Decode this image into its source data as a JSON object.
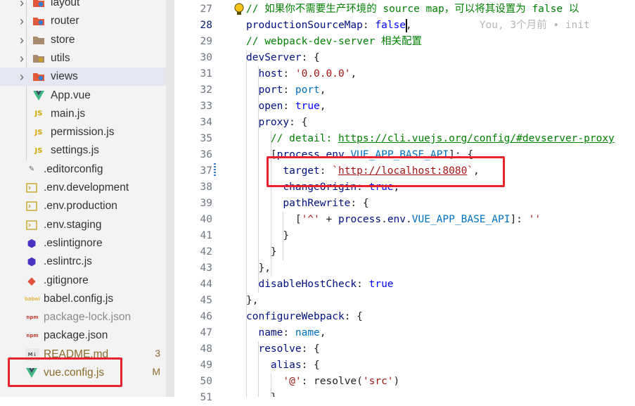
{
  "explorer": {
    "items": [
      {
        "label": "layout",
        "kind": "folder",
        "icon": "layout-folder-icon"
      },
      {
        "label": "router",
        "kind": "folder",
        "icon": "router-folder-icon"
      },
      {
        "label": "store",
        "kind": "folder",
        "icon": "store-folder-icon"
      },
      {
        "label": "utils",
        "kind": "folder",
        "icon": "utils-folder-icon"
      },
      {
        "label": "views",
        "kind": "folder",
        "icon": "views-folder-icon"
      },
      {
        "label": "App.vue",
        "kind": "file",
        "icon": "vue-file-icon"
      },
      {
        "label": "main.js",
        "kind": "file",
        "icon": "js-file-icon"
      },
      {
        "label": "permission.js",
        "kind": "file",
        "icon": "js-file-icon"
      },
      {
        "label": "settings.js",
        "kind": "file",
        "icon": "js-file-icon"
      },
      {
        "label": ".editorconfig",
        "kind": "file",
        "icon": "editorconfig-icon"
      },
      {
        "label": ".env.development",
        "kind": "file",
        "icon": "env-file-icon"
      },
      {
        "label": ".env.production",
        "kind": "file",
        "icon": "env-file-icon"
      },
      {
        "label": ".env.staging",
        "kind": "file",
        "icon": "env-file-icon"
      },
      {
        "label": ".eslintignore",
        "kind": "file",
        "icon": "eslint-icon"
      },
      {
        "label": ".eslintrc.js",
        "kind": "file",
        "icon": "eslint-icon"
      },
      {
        "label": ".gitignore",
        "kind": "file",
        "icon": "git-icon"
      },
      {
        "label": "babel.config.js",
        "kind": "file",
        "icon": "babel-icon"
      },
      {
        "label": "package-lock.json",
        "kind": "file",
        "icon": "npm-icon"
      },
      {
        "label": "package.json",
        "kind": "file",
        "icon": "npm-icon"
      },
      {
        "label": "README.md",
        "kind": "file",
        "icon": "markdown-icon",
        "badge": "3"
      },
      {
        "label": "vue.config.js",
        "kind": "file",
        "icon": "vue-file-icon",
        "badge": "M"
      }
    ],
    "icon_glyphs": {
      "js": "JS",
      "npm": "npm",
      "md": "M↓",
      "babel": "babel"
    }
  },
  "editor": {
    "line_numbers": [
      "27",
      "28",
      "29",
      "30",
      "31",
      "32",
      "33",
      "34",
      "35",
      "36",
      "37",
      "38",
      "39",
      "40",
      "41",
      "42",
      "43",
      "44",
      "45",
      "46",
      "47",
      "48",
      "49",
      "50",
      "51"
    ],
    "current_line": "28",
    "lines": [
      [
        {
          "t": "// 如果你不需要生产环境的 source map，可以将其设置为 false 以",
          "c": "cm"
        }
      ],
      [
        {
          "t": "productionSourceMap",
          "c": "prop"
        },
        {
          "t": ": ",
          "c": "plain"
        },
        {
          "t": "false",
          "c": "kw"
        },
        {
          "t": ",",
          "c": "plain"
        },
        {
          "t": "           You, 3个月前 • init",
          "c": "blame"
        }
      ],
      [
        {
          "t": "// webpack-dev-server 相关配置",
          "c": "cm"
        }
      ],
      [
        {
          "t": "devServer",
          "c": "prop"
        },
        {
          "t": ": {",
          "c": "plain"
        }
      ],
      [
        {
          "t": "  host",
          "c": "prop"
        },
        {
          "t": ": ",
          "c": "plain"
        },
        {
          "t": "'0.0.0.0'",
          "c": "str"
        },
        {
          "t": ",",
          "c": "plain"
        }
      ],
      [
        {
          "t": "  port",
          "c": "prop"
        },
        {
          "t": ": ",
          "c": "plain"
        },
        {
          "t": "port",
          "c": "const"
        },
        {
          "t": ",",
          "c": "plain"
        }
      ],
      [
        {
          "t": "  open",
          "c": "prop"
        },
        {
          "t": ": ",
          "c": "plain"
        },
        {
          "t": "true",
          "c": "kw"
        },
        {
          "t": ",",
          "c": "plain"
        }
      ],
      [
        {
          "t": "  proxy",
          "c": "prop"
        },
        {
          "t": ": {",
          "c": "plain"
        }
      ],
      [
        {
          "t": "    // detail: ",
          "c": "cm"
        },
        {
          "t": "https://cli.vuejs.org/config/#devserver-proxy",
          "c": "cmlink"
        }
      ],
      [
        {
          "t": "    [",
          "c": "plain"
        },
        {
          "t": "process",
          "c": "prop"
        },
        {
          "t": ".",
          "c": "plain"
        },
        {
          "t": "env",
          "c": "prop"
        },
        {
          "t": ".",
          "c": "plain"
        },
        {
          "t": "VUE_APP_BASE_API",
          "c": "const"
        },
        {
          "t": "]: {",
          "c": "plain"
        }
      ],
      [
        {
          "t": "      target",
          "c": "prop"
        },
        {
          "t": ": ",
          "c": "plain"
        },
        {
          "t": "`",
          "c": "str"
        },
        {
          "t": "http://localhost:8080",
          "c": "link"
        },
        {
          "t": "`",
          "c": "str"
        },
        {
          "t": ",",
          "c": "plain"
        }
      ],
      [
        {
          "t": "      changeOrigin",
          "c": "prop"
        },
        {
          "t": ": ",
          "c": "plain"
        },
        {
          "t": "true",
          "c": "kw"
        },
        {
          "t": ",",
          "c": "plain"
        }
      ],
      [
        {
          "t": "      pathRewrite",
          "c": "prop"
        },
        {
          "t": ": {",
          "c": "plain"
        }
      ],
      [
        {
          "t": "        [",
          "c": "plain"
        },
        {
          "t": "'^'",
          "c": "str"
        },
        {
          "t": " + ",
          "c": "plain"
        },
        {
          "t": "process",
          "c": "prop"
        },
        {
          "t": ".",
          "c": "plain"
        },
        {
          "t": "env",
          "c": "prop"
        },
        {
          "t": ".",
          "c": "plain"
        },
        {
          "t": "VUE_APP_BASE_API",
          "c": "const"
        },
        {
          "t": "]: ",
          "c": "plain"
        },
        {
          "t": "''",
          "c": "str"
        }
      ],
      [
        {
          "t": "      }",
          "c": "plain"
        }
      ],
      [
        {
          "t": "    }",
          "c": "plain"
        }
      ],
      [
        {
          "t": "  },",
          "c": "plain"
        }
      ],
      [
        {
          "t": "  disableHostCheck",
          "c": "prop"
        },
        {
          "t": ": ",
          "c": "plain"
        },
        {
          "t": "true",
          "c": "kw"
        }
      ],
      [
        {
          "t": "},",
          "c": "plain"
        }
      ],
      [
        {
          "t": "configureWebpack",
          "c": "prop"
        },
        {
          "t": ": {",
          "c": "plain"
        }
      ],
      [
        {
          "t": "  name",
          "c": "prop"
        },
        {
          "t": ": ",
          "c": "plain"
        },
        {
          "t": "name",
          "c": "const"
        },
        {
          "t": ",",
          "c": "plain"
        }
      ],
      [
        {
          "t": "  resolve",
          "c": "prop"
        },
        {
          "t": ": {",
          "c": "plain"
        }
      ],
      [
        {
          "t": "    alias",
          "c": "prop"
        },
        {
          "t": ": {",
          "c": "plain"
        }
      ],
      [
        {
          "t": "      '@'",
          "c": "str"
        },
        {
          "t": ": ",
          "c": "plain"
        },
        {
          "t": "resolve",
          "c": "plain"
        },
        {
          "t": "(",
          "c": "plain"
        },
        {
          "t": "'src'",
          "c": "str"
        },
        {
          "t": ")",
          "c": "plain"
        }
      ],
      [
        {
          "t": "    }",
          "c": "plain"
        }
      ]
    ]
  },
  "colors": {
    "highlight_box": "#e8232e",
    "selected_row": "#e4e6f1",
    "comment": "#008000",
    "string": "#a31515",
    "keyword": "#0000ff",
    "property": "#001080"
  }
}
